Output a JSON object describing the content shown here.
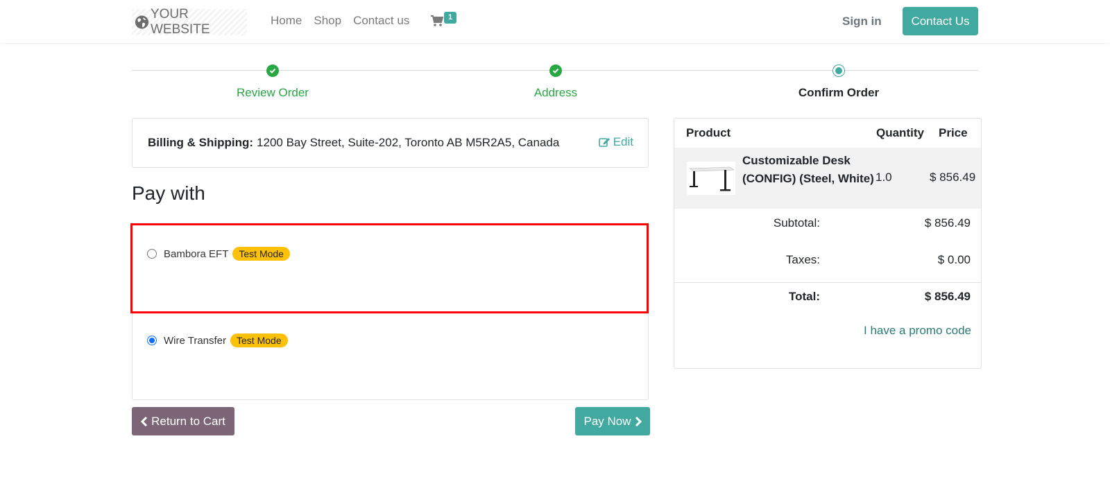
{
  "header": {
    "logo_text": "YOUR WEBSITE",
    "nav": [
      "Home",
      "Shop",
      "Contact us"
    ],
    "cart_count": "1",
    "signin_label": "Sign in",
    "contact_button_label": "Contact Us"
  },
  "steps": [
    {
      "label": "Review Order",
      "state": "done"
    },
    {
      "label": "Address",
      "state": "done"
    },
    {
      "label": "Confirm Order",
      "state": "current"
    }
  ],
  "billing": {
    "label": "Billing & Shipping:",
    "address": "1200 Bay Street, Suite-202, Toronto AB M5R2A5, Canada",
    "edit_label": "Edit"
  },
  "payment": {
    "heading": "Pay with",
    "methods": [
      {
        "name": "Bambora EFT",
        "badge": "Test Mode",
        "selected": false
      },
      {
        "name": "Wire Transfer",
        "badge": "Test Mode",
        "selected": true
      }
    ],
    "return_label": "Return to Cart",
    "pay_label": "Pay Now"
  },
  "summary": {
    "headers": {
      "product": "Product",
      "quantity": "Quantity",
      "price": "Price"
    },
    "items": [
      {
        "name": "Customizable Desk (CONFIG) (Steel, White)",
        "quantity": "1.0",
        "price": "$ 856.49"
      }
    ],
    "subtotal_label": "Subtotal:",
    "subtotal": "$ 856.49",
    "taxes_label": "Taxes:",
    "taxes": "$ 0.00",
    "total_label": "Total:",
    "total": "$ 856.49",
    "promo_label": "I have a promo code"
  },
  "colors": {
    "primary": "#41a9a0",
    "success": "#28a745",
    "secondary_button": "#7c6576",
    "badge": "#ffc107",
    "highlight": "#ff0000"
  }
}
